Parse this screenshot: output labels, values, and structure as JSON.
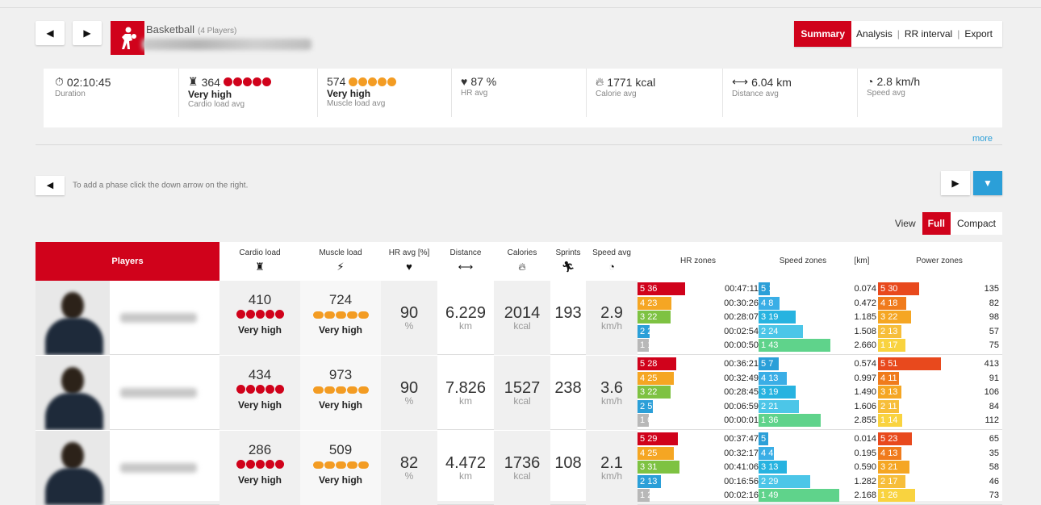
{
  "header": {
    "sport": "Basketball",
    "players_count": "(4 Players)",
    "tabs": [
      "Summary",
      "Analysis",
      "RR interval",
      "Export"
    ]
  },
  "stats": [
    {
      "icon": "stopwatch-icon",
      "value": "02:10:45",
      "label": "Duration"
    },
    {
      "icon": "cardio-load-icon",
      "value": "364",
      "level": "Very high",
      "label": "Cardio load avg",
      "dot_color": "#d0021b"
    },
    {
      "icon": "muscle-load-icon",
      "value": "574",
      "level": "Very high",
      "label": "Muscle load avg",
      "dot_color": "#f39c23"
    },
    {
      "icon": "heart-icon",
      "value": "87 %",
      "label": "HR avg"
    },
    {
      "icon": "flame-icon",
      "value": "1771 kcal",
      "label": "Calorie avg"
    },
    {
      "icon": "distance-icon",
      "value": "6.04 km",
      "label": "Distance avg"
    },
    {
      "icon": "speedometer-icon",
      "value": "2.8 km/h",
      "label": "Speed avg"
    }
  ],
  "more_link": "more",
  "phase_hint": "To add a phase click the down arrow on the right.",
  "view": {
    "label": "View",
    "full": "Full",
    "compact": "Compact"
  },
  "columns": {
    "players": "Players",
    "cardio": "Cardio load",
    "muscle": "Muscle load",
    "hr": "HR avg [%]",
    "distance": "Distance",
    "calories": "Calories",
    "sprints": "Sprints",
    "speed": "Speed avg",
    "hr_zones": "HR zones",
    "speed_zones": "Speed zones",
    "km": "[km]",
    "power_zones": "Power zones"
  },
  "units": {
    "hr": "%",
    "distance": "km",
    "calories": "kcal",
    "speed": "km/h"
  },
  "players": [
    {
      "cardio": "410",
      "cardio_level": "Very high",
      "muscle": "724",
      "muscle_level": "Very high",
      "hr": "90",
      "distance": "6.229",
      "calories": "2014",
      "sprints": "193",
      "speed": "2.9",
      "zones": [
        {
          "hr_zone": "5",
          "hr_pct": "36",
          "time": "00:47:11",
          "spd_zone": "5",
          "spd_pct": "1",
          "km": "0.074",
          "pw_zone": "5",
          "pw_pct": "30",
          "power": "135"
        },
        {
          "hr_zone": "4",
          "hr_pct": "23",
          "time": "00:30:26",
          "spd_zone": "4",
          "spd_pct": "8",
          "km": "0.472",
          "pw_zone": "4",
          "pw_pct": "18",
          "power": "82"
        },
        {
          "hr_zone": "3",
          "hr_pct": "22",
          "time": "00:28:07",
          "spd_zone": "3",
          "spd_pct": "19",
          "km": "1.185",
          "pw_zone": "3",
          "pw_pct": "22",
          "power": "98"
        },
        {
          "hr_zone": "2",
          "hr_pct": "2",
          "time": "00:02:54",
          "spd_zone": "2",
          "spd_pct": "24",
          "km": "1.508",
          "pw_zone": "2",
          "pw_pct": "13",
          "power": "57"
        },
        {
          "hr_zone": "1",
          "hr_pct": "1",
          "time": "00:00:50",
          "spd_zone": "1",
          "spd_pct": "43",
          "km": "2.660",
          "pw_zone": "1",
          "pw_pct": "17",
          "power": "75"
        }
      ]
    },
    {
      "cardio": "434",
      "cardio_level": "Very high",
      "muscle": "973",
      "muscle_level": "Very high",
      "hr": "90",
      "distance": "7.826",
      "calories": "1527",
      "sprints": "238",
      "speed": "3.6",
      "zones": [
        {
          "hr_zone": "5",
          "hr_pct": "28",
          "time": "00:36:21",
          "spd_zone": "5",
          "spd_pct": "7",
          "km": "0.574",
          "pw_zone": "5",
          "pw_pct": "51",
          "power": "413"
        },
        {
          "hr_zone": "4",
          "hr_pct": "25",
          "time": "00:32:49",
          "spd_zone": "4",
          "spd_pct": "13",
          "km": "0.997",
          "pw_zone": "4",
          "pw_pct": "11",
          "power": "91"
        },
        {
          "hr_zone": "3",
          "hr_pct": "22",
          "time": "00:28:45",
          "spd_zone": "3",
          "spd_pct": "19",
          "km": "1.490",
          "pw_zone": "3",
          "pw_pct": "13",
          "power": "106"
        },
        {
          "hr_zone": "2",
          "hr_pct": "5",
          "time": "00:06:59",
          "spd_zone": "2",
          "spd_pct": "21",
          "km": "1.606",
          "pw_zone": "2",
          "pw_pct": "11",
          "power": "84"
        },
        {
          "hr_zone": "1",
          "hr_pct": "0",
          "time": "00:00:01",
          "spd_zone": "1",
          "spd_pct": "36",
          "km": "2.855",
          "pw_zone": "1",
          "pw_pct": "14",
          "power": "112"
        }
      ]
    },
    {
      "cardio": "286",
      "cardio_level": "Very high",
      "muscle": "509",
      "muscle_level": "Very high",
      "hr": "82",
      "distance": "4.472",
      "calories": "1736",
      "sprints": "108",
      "speed": "2.1",
      "zones": [
        {
          "hr_zone": "5",
          "hr_pct": "29",
          "time": "00:37:47",
          "spd_zone": "5",
          "spd_pct": "0",
          "km": "0.014",
          "pw_zone": "5",
          "pw_pct": "23",
          "power": "65"
        },
        {
          "hr_zone": "4",
          "hr_pct": "25",
          "time": "00:32:17",
          "spd_zone": "4",
          "spd_pct": "4",
          "km": "0.195",
          "pw_zone": "4",
          "pw_pct": "13",
          "power": "35"
        },
        {
          "hr_zone": "3",
          "hr_pct": "31",
          "time": "00:41:06",
          "spd_zone": "3",
          "spd_pct": "13",
          "km": "0.590",
          "pw_zone": "3",
          "pw_pct": "21",
          "power": "58"
        },
        {
          "hr_zone": "2",
          "hr_pct": "13",
          "time": "00:16:56",
          "spd_zone": "2",
          "spd_pct": "29",
          "km": "1.282",
          "pw_zone": "2",
          "pw_pct": "17",
          "power": "46"
        },
        {
          "hr_zone": "1",
          "hr_pct": "2",
          "time": "00:02:16",
          "spd_zone": "1",
          "spd_pct": "49",
          "km": "2.168",
          "pw_zone": "1",
          "pw_pct": "26",
          "power": "73"
        }
      ]
    }
  ],
  "colors": {
    "accent": "#d0021b",
    "muscle": "#f39c23",
    "hr_zone": [
      "#d0021b",
      "#f5a623",
      "#7ec242",
      "#2b9fd8",
      "#b8b8b8"
    ],
    "speed_zone": [
      "#2b9fd8",
      "#3aaee6",
      "#27b3e0",
      "#4cc6e8",
      "#5fd38b"
    ],
    "power_zone": [
      "#e8491d",
      "#f07b1c",
      "#f5a623",
      "#f7be3a",
      "#f9d33f"
    ]
  }
}
